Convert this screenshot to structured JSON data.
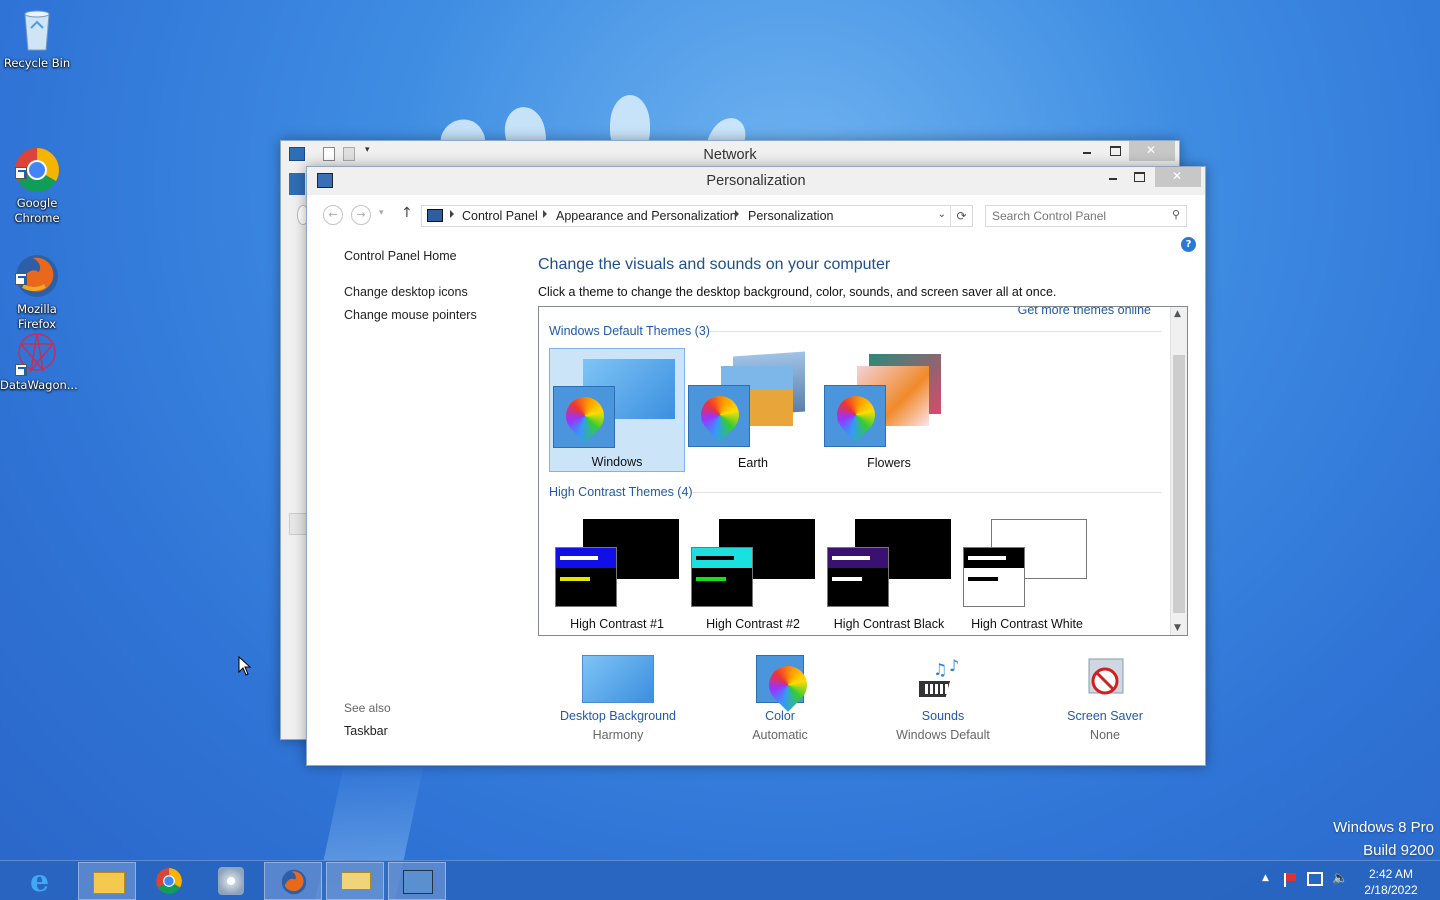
{
  "desktop": {
    "icons": [
      {
        "label": "Recycle Bin",
        "icon": "recycle-bin-icon"
      },
      {
        "label": "Google\nChrome",
        "icon": "chrome-icon"
      },
      {
        "label": "Mozilla\nFirefox",
        "icon": "firefox-icon"
      },
      {
        "label": "DataWagon...",
        "icon": "datawagon-icon"
      }
    ],
    "watermark": {
      "line1": "Windows 8 Pro",
      "line2": "Build 9200"
    }
  },
  "network_window": {
    "title": "Network"
  },
  "window": {
    "title": "Personalization",
    "breadcrumb": [
      "Control Panel",
      "Appearance and Personalization",
      "Personalization"
    ],
    "search_placeholder": "Search Control Panel",
    "help": "?"
  },
  "sidebar": {
    "links": [
      "Control Panel Home",
      "Change desktop icons",
      "Change mouse pointers"
    ],
    "see_also_heading": "See also",
    "see_also": [
      "Taskbar"
    ]
  },
  "main": {
    "heading": "Change the visuals and sounds on your computer",
    "description": "Click a theme to change the desktop background, color, sounds, and screen saver all at once.",
    "get_more": "Get more themes online",
    "default_group": "Windows Default Themes (3)",
    "default_themes": [
      "Windows",
      "Earth",
      "Flowers"
    ],
    "contrast_group": "High Contrast Themes (4)",
    "contrast_themes": [
      "High Contrast #1",
      "High Contrast #2",
      "High Contrast Black",
      "High Contrast White"
    ],
    "selected_theme": "Windows"
  },
  "settings": [
    {
      "label": "Desktop Background",
      "value": "Harmony",
      "icon": "desktop-background-icon"
    },
    {
      "label": "Color",
      "value": "Automatic",
      "icon": "color-icon"
    },
    {
      "label": "Sounds",
      "value": "Windows Default",
      "icon": "sounds-icon"
    },
    {
      "label": "Screen Saver",
      "value": "None",
      "icon": "screen-saver-icon"
    }
  ],
  "taskbar": {
    "apps": [
      "internet-explorer-icon",
      "file-explorer-icon",
      "chrome-icon",
      "disc-app-icon",
      "firefox-icon",
      "search-app-icon",
      "control-panel-icon"
    ],
    "time": "2:42 AM",
    "date": "2/18/2022"
  },
  "colors": {
    "link": "#1e5aa8",
    "heading": "#1e4f91",
    "selected": "#cce4f7",
    "taskbar": "#2864be"
  }
}
